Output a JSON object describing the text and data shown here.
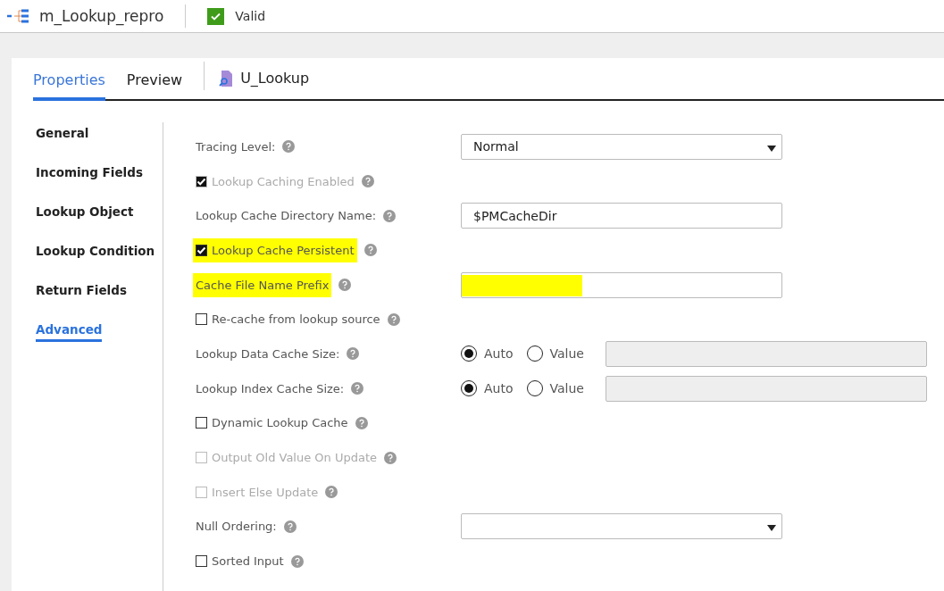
{
  "header": {
    "title": "m_Lookup_repro",
    "status": "Valid"
  },
  "tabs": [
    {
      "label": "Properties",
      "selected": true
    },
    {
      "label": "Preview",
      "selected": false
    }
  ],
  "object": {
    "name": "U_Lookup"
  },
  "sidebar": {
    "items": [
      {
        "label": "General",
        "selected": false
      },
      {
        "label": "Incoming Fields",
        "selected": false
      },
      {
        "label": "Lookup Object",
        "selected": false
      },
      {
        "label": "Lookup Condition",
        "selected": false
      },
      {
        "label": "Return Fields",
        "selected": false
      },
      {
        "label": "Advanced",
        "selected": true
      }
    ]
  },
  "rows": [
    {
      "kind": "select",
      "label": "Tracing Level:",
      "value": "Normal"
    },
    {
      "kind": "checkbox",
      "label": "Lookup Caching Enabled",
      "checked": true,
      "disabled": true
    },
    {
      "kind": "text",
      "label": "Lookup Cache Directory Name:",
      "value": "$PMCacheDir"
    },
    {
      "kind": "checkbox",
      "label": "Lookup Cache Persistent",
      "checked": true,
      "disabled": false,
      "highlighted": true
    },
    {
      "kind": "text",
      "label": "Cache File Name Prefix",
      "highlighted": true
    },
    {
      "kind": "checkbox",
      "label": "Re-cache from lookup source",
      "checked": false,
      "disabled": false
    },
    {
      "kind": "radio",
      "label": "Lookup Data Cache Size:",
      "options": [
        {
          "label": "Auto",
          "selected": true
        },
        {
          "label": "Value",
          "selected": false
        }
      ]
    },
    {
      "kind": "radio",
      "label": "Lookup Index Cache Size:",
      "options": [
        {
          "label": "Auto",
          "selected": true
        },
        {
          "label": "Value",
          "selected": false
        }
      ]
    },
    {
      "kind": "checkbox",
      "label": "Dynamic Lookup Cache",
      "checked": false,
      "disabled": false
    },
    {
      "kind": "checkbox",
      "label": "Output Old Value On Update",
      "checked": false,
      "disabled": true
    },
    {
      "kind": "checkbox",
      "label": "Insert Else Update",
      "checked": false,
      "disabled": true
    },
    {
      "kind": "select",
      "label": "Null Ordering:"
    },
    {
      "kind": "checkbox",
      "label": "Sorted Input",
      "checked": false,
      "disabled": false
    }
  ]
}
